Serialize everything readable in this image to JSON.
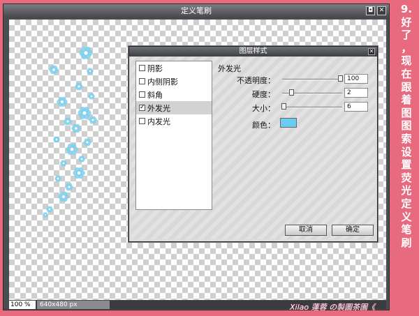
{
  "window": {
    "title": "定义笔刷",
    "btn_restore": "◘",
    "btn_close": "✕"
  },
  "status": {
    "zoom": "100 %",
    "dims": "640x480 px"
  },
  "dialog": {
    "title": "图层样式",
    "close": "✕",
    "styles": [
      {
        "label": "阴影",
        "checked": false
      },
      {
        "label": "内侧阴影",
        "checked": false
      },
      {
        "label": "斜角",
        "checked": false
      },
      {
        "label": "外发光",
        "checked": true
      },
      {
        "label": "内发光",
        "checked": false
      }
    ],
    "panel_title": "外发光",
    "opacity_label": "不透明度：",
    "opacity_value": "100",
    "hardness_label": "硬度：",
    "hardness_value": "2",
    "size_label": "大小：",
    "size_value": "6",
    "color_label": "颜色：",
    "glow_color": "#6dcaf2",
    "cancel": "取消",
    "ok": "确定"
  },
  "side_caption": [
    "9.",
    "好",
    "了",
    "，",
    "现",
    "在",
    "跟",
    "着",
    "图",
    "图",
    "索",
    "设",
    "置",
    "荧",
    "光",
    "定",
    "义",
    "笔",
    "刷"
  ],
  "credit": "Xilao 蓮蓉 の製圖茶園《",
  "flake_color": "#7fd0ec"
}
